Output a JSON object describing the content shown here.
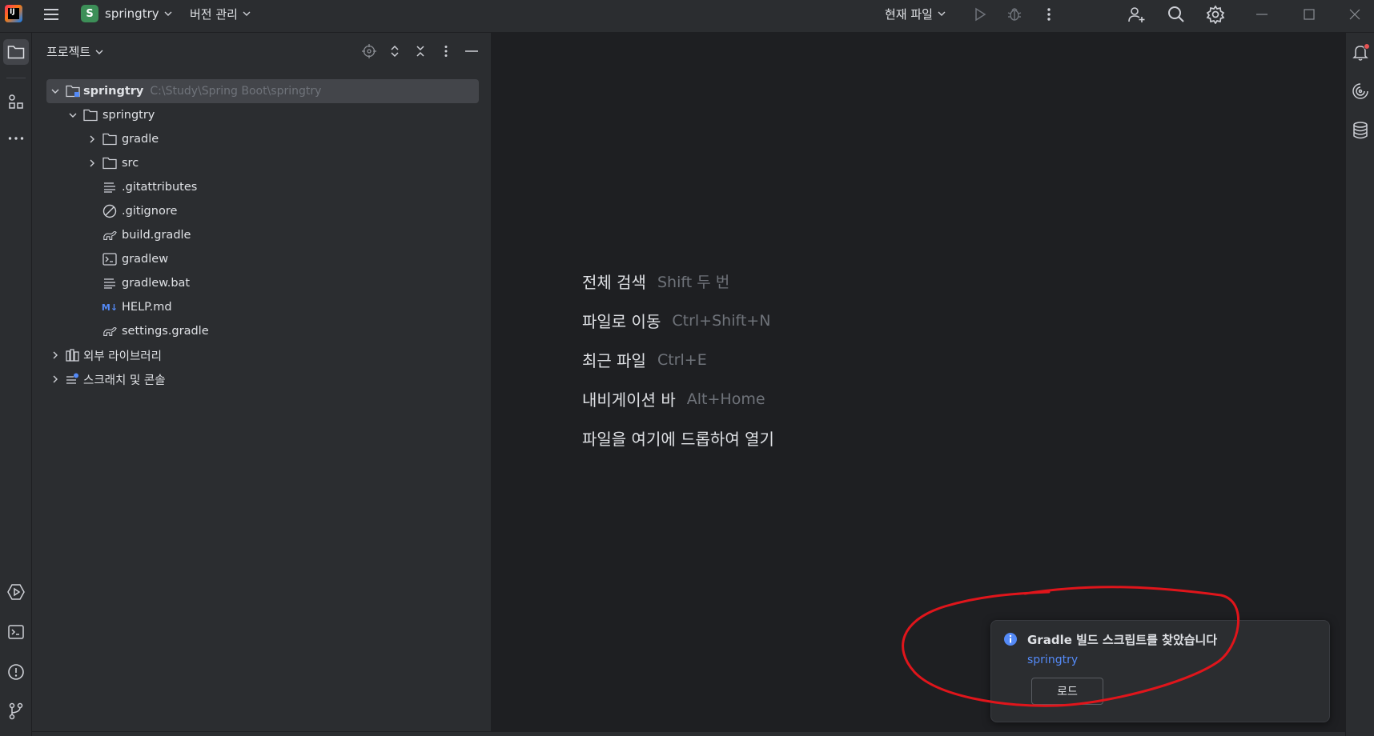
{
  "titlebar": {
    "app_logo_text": "IJ",
    "project_badge": "S",
    "project_name": "springtry",
    "vcs_label": "버전 관리",
    "run_config_label": "현재 파일",
    "icons": [
      "hamburger-menu-icon",
      "chevron-down-icon",
      "run-icon",
      "debug-icon",
      "more-vertical-icon",
      "add-user-icon",
      "search-icon",
      "settings-gear-icon",
      "minimize-icon",
      "maximize-icon",
      "close-icon"
    ]
  },
  "left_strip": {
    "icons": [
      "project-folder-icon",
      "structure-icon",
      "more-tools-icon",
      "run-services-icon",
      "terminal-icon",
      "problems-icon",
      "git-branch-icon"
    ]
  },
  "project_panel": {
    "title": "프로젝트",
    "tool_icons": [
      "locate-icon",
      "expand-collapse-icon",
      "close-x-icon",
      "more-vertical-icon",
      "hide-icon"
    ],
    "tree": [
      {
        "label": "springtry",
        "path": "C:\\Study\\Spring Boot\\springtry",
        "icon": "project-module-icon",
        "expanded": true,
        "bold": true
      },
      {
        "label": "springtry",
        "icon": "folder-icon",
        "expanded": true
      },
      {
        "label": "gradle",
        "icon": "folder-icon",
        "expanded": false
      },
      {
        "label": "src",
        "icon": "folder-icon",
        "expanded": false
      },
      {
        "label": ".gitattributes",
        "icon": "text-file-icon"
      },
      {
        "label": ".gitignore",
        "icon": "ignore-file-icon"
      },
      {
        "label": "build.gradle",
        "icon": "gradle-file-icon"
      },
      {
        "label": "gradlew",
        "icon": "shell-script-icon"
      },
      {
        "label": "gradlew.bat",
        "icon": "text-file-icon"
      },
      {
        "label": "HELP.md",
        "icon": "markdown-file-icon",
        "icon_text": "M↓"
      },
      {
        "label": "settings.gradle",
        "icon": "gradle-file-icon"
      },
      {
        "label": "외부 라이브러리",
        "icon": "library-icon",
        "expanded": false
      },
      {
        "label": "스크래치 및 콘솔",
        "icon": "scratch-icon",
        "expanded": false
      }
    ]
  },
  "editor": {
    "hints": [
      {
        "text": "전체 검색",
        "key": "Shift 두 번"
      },
      {
        "text": "파일로 이동",
        "key": "Ctrl+Shift+N"
      },
      {
        "text": "최근 파일",
        "key": "Ctrl+E"
      },
      {
        "text": "내비게이션 바",
        "key": "Alt+Home"
      },
      {
        "text": "파일을 여기에 드롭하여 열기",
        "key": ""
      }
    ]
  },
  "right_strip": {
    "icons": [
      "notifications-bell-icon",
      "ai-assistant-icon",
      "database-icon"
    ]
  },
  "notification": {
    "title": "Gradle 빌드 스크립트를 찾았습니다",
    "link": "springtry",
    "button": "로드"
  },
  "colors": {
    "background": "#2b2d30",
    "editor_background": "#1e1f22",
    "text": "#dfe1e5",
    "muted": "#6f737a",
    "link": "#548af7",
    "annotation_red": "#e0151b",
    "project_badge": "#3d8f58"
  }
}
